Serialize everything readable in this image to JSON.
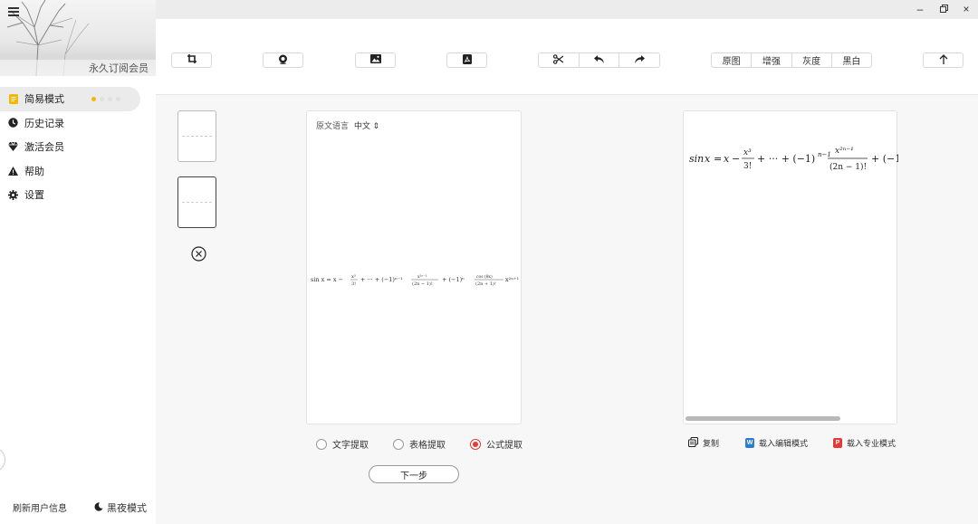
{
  "sidebar": {
    "member_label": "永久订阅会员",
    "nav": [
      {
        "label": "简易模式",
        "icon": "document-icon",
        "active": true
      },
      {
        "label": "历史记录",
        "icon": "clock-icon"
      },
      {
        "label": "激活会员",
        "icon": "diamond-icon"
      },
      {
        "label": "帮助",
        "icon": "warning-icon"
      },
      {
        "label": "设置",
        "icon": "gear-icon"
      }
    ],
    "refresh_label": "刷新用户信息",
    "night_label": "黑夜模式"
  },
  "toolbar": {
    "image_modes": [
      "原图",
      "增强",
      "灰度",
      "黑白"
    ]
  },
  "source": {
    "lang_label": "原文语言",
    "lang_value": "中文"
  },
  "extract": {
    "options": [
      "文字提取",
      "表格提取",
      "公式提取"
    ],
    "selected": 2
  },
  "next_label": "下一步",
  "result_actions": {
    "copy": "复制",
    "load_edit": "载入编辑模式",
    "load_pro": "载入专业模式"
  },
  "colors": {
    "accent_red": "#e53935",
    "active_dot": "#f5b800",
    "word_blue": "#2b7cd3",
    "pdf_red": "#e53935"
  }
}
